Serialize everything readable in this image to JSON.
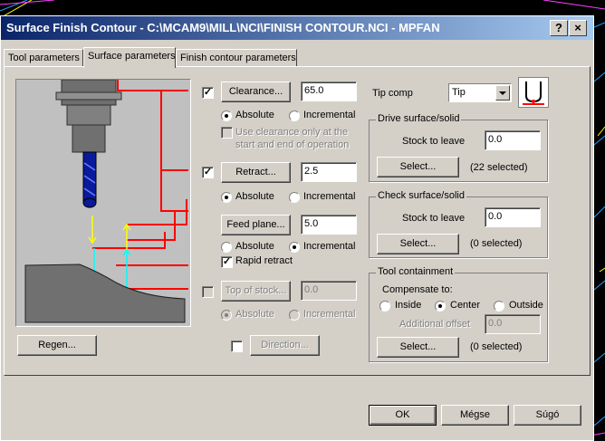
{
  "window": {
    "title": "Surface Finish Contour - C:\\MCAM9\\MILL\\NCI\\FINISH CONTOUR.NCI - MPFAN",
    "help_glyph": "?",
    "close_glyph": "×"
  },
  "tabs": [
    {
      "label": "Tool parameters"
    },
    {
      "label": "Surface parameters"
    },
    {
      "label": "Finish contour parameters"
    }
  ],
  "left": {
    "clearance": {
      "checked": "✓",
      "button": "Clearance...",
      "value": "65.0",
      "absolute": "Absolute",
      "incremental": "Incremental",
      "use_clearance": "Use clearance only at the start and end of operation"
    },
    "retract": {
      "checked": "✓",
      "button": "Retract...",
      "value": "2.5",
      "absolute": "Absolute",
      "incremental": "Incremental"
    },
    "feed_plane": {
      "button": "Feed plane...",
      "value": "5.0",
      "absolute": "Absolute",
      "incremental": "Incremental",
      "rapid_checked": "✓",
      "rapid_retract": "Rapid retract"
    },
    "top_of_stock": {
      "button": "Top of stock...",
      "value": "0.0",
      "absolute": "Absolute",
      "incremental": "Incremental"
    },
    "direction": {
      "button": "Direction..."
    },
    "regen": {
      "button": "Regen..."
    }
  },
  "right": {
    "tip_comp": {
      "label": "Tip comp",
      "value": "Tip"
    },
    "drive": {
      "title": "Drive surface/solid",
      "stock_label": "Stock to leave",
      "stock_value": "0.0",
      "select": "Select...",
      "selected": "(22  selected)"
    },
    "check": {
      "title": "Check surface/solid",
      "stock_label": "Stock to leave",
      "stock_value": "0.0",
      "select": "Select...",
      "selected": "(0  selected)"
    },
    "containment": {
      "title": "Tool containment",
      "compensate": "Compensate to:",
      "inside": "Inside",
      "center": "Center",
      "outside": "Outside",
      "offset_label": "Additional offset",
      "offset_value": "0.0",
      "select": "Select...",
      "selected": "(0  selected)"
    }
  },
  "footer": {
    "ok": "OK",
    "cancel": "Mégse",
    "help": "Súgó"
  },
  "colors": {
    "title_start": "#0a246a",
    "title_end": "#a6caf0",
    "face": "#d4d0c8",
    "diagram_red": "#ff0000"
  }
}
